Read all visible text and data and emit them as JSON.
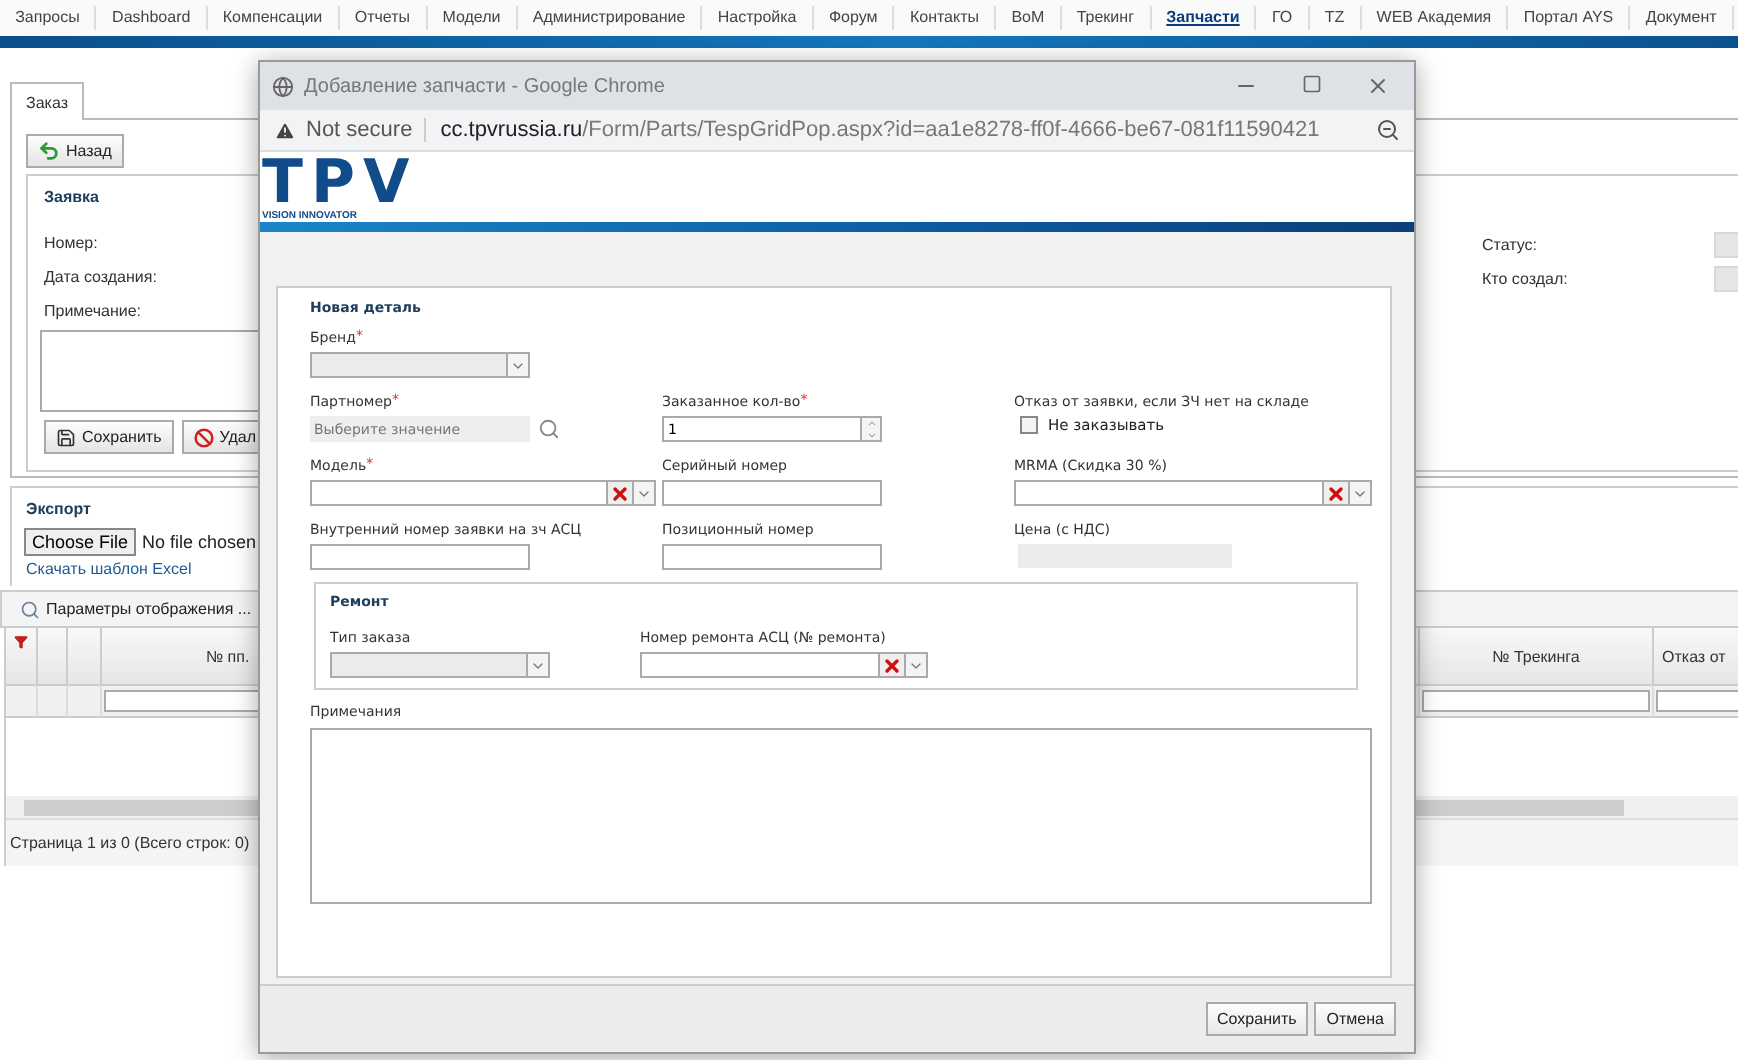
{
  "nav": [
    {
      "label": "Запросы",
      "selected": false
    },
    {
      "label": "Dashboard",
      "selected": false
    },
    {
      "label": "Компенсации",
      "selected": false
    },
    {
      "label": "Отчеты",
      "selected": false
    },
    {
      "label": "Модели",
      "selected": false
    },
    {
      "label": "Администрирование",
      "selected": false
    },
    {
      "label": "Настройка",
      "selected": false
    },
    {
      "label": "Форум",
      "selected": false
    },
    {
      "label": "Контакты",
      "selected": false
    },
    {
      "label": "BoM",
      "selected": false
    },
    {
      "label": "Трекинг",
      "selected": false
    },
    {
      "label": "Запчасти",
      "selected": true
    },
    {
      "label": "ГО",
      "selected": false
    },
    {
      "label": "TZ",
      "selected": false
    },
    {
      "label": "WEB Академия",
      "selected": false
    },
    {
      "label": "Портал AYS",
      "selected": false
    },
    {
      "label": "Документ",
      "selected": false
    }
  ],
  "tabs": [
    {
      "label": "Заказ",
      "selected": true
    }
  ],
  "back_button": "Назад",
  "request": {
    "title": "Заявка",
    "fields": [
      {
        "label": "Номер:"
      },
      {
        "label": "Дата создания:"
      }
    ],
    "note_label": "Примечание:",
    "buttons": [
      {
        "label": "Сохранить",
        "kind": "save"
      },
      {
        "label": "Удал",
        "kind": "delete"
      }
    ],
    "side_fields": [
      {
        "label": "Статус:"
      },
      {
        "label": "Кто создал:"
      }
    ]
  },
  "export": {
    "title": "Экспорт",
    "file_button": "Choose File",
    "file_status": "No file chosen",
    "template_link": "Скачать шаблон Excel"
  },
  "grid": {
    "toolbar_button": "Параметры отображения ...",
    "columns": [
      {
        "label": "№ пп."
      },
      {
        "label": "№ Трекинга"
      },
      {
        "label": "Отказ от"
      }
    ],
    "pager": "Страница 1 из 0 (Всего строк: 0)"
  },
  "popup": {
    "title": "Добавление запчасти - Google Chrome",
    "security": "Not secure",
    "url_host": "cc.tpvrussia.ru",
    "url_path": "/Form/Parts/TespGridPop.aspx?id=aa1e8278-ff0f-4666-be67-081f11590421",
    "logo": {
      "letters": "TPV",
      "tagline": "VISION INNOVATOR"
    },
    "section_title": "Новая деталь",
    "rows": [
      {
        "fields": [
          {
            "label": "Бренд",
            "mark": "*",
            "kind": "select",
            "disabled": true
          }
        ]
      },
      {
        "fields": [
          {
            "label": "Партномер",
            "mark": "*",
            "kind": "lookup",
            "placeholder": "Выберите значение"
          },
          {
            "label": "Заказанное кол-во",
            "mark": "*",
            "kind": "spin",
            "value": "1"
          },
          {
            "label": "Отказ от заявки, если ЗЧ нет на складе",
            "kind": "checkbox",
            "option": "Не заказывать",
            "checked": false
          }
        ]
      },
      {
        "fields": [
          {
            "label": "Модель",
            "mark": "*",
            "kind": "combo"
          },
          {
            "label": "Серийный номер",
            "kind": "text"
          },
          {
            "label": "MRMA (Скидка 30 %)",
            "kind": "combo"
          }
        ]
      },
      {
        "fields": [
          {
            "label": "Внутренний номер заявки на зч АСЦ",
            "kind": "text"
          },
          {
            "label": "Позиционный номер",
            "kind": "text"
          },
          {
            "label": "Цена (с НДС)",
            "kind": "readonly"
          }
        ]
      }
    ],
    "repair": {
      "title": "Ремонт",
      "fields": [
        {
          "label": "Тип заказа",
          "kind": "select",
          "disabled": true
        },
        {
          "label": "Номер ремонта АСЦ (№ ремонта)",
          "kind": "combo"
        }
      ]
    },
    "notes_label": "Примечания",
    "buttons": [
      {
        "label": "Сохранить"
      },
      {
        "label": "Отмена"
      }
    ]
  }
}
